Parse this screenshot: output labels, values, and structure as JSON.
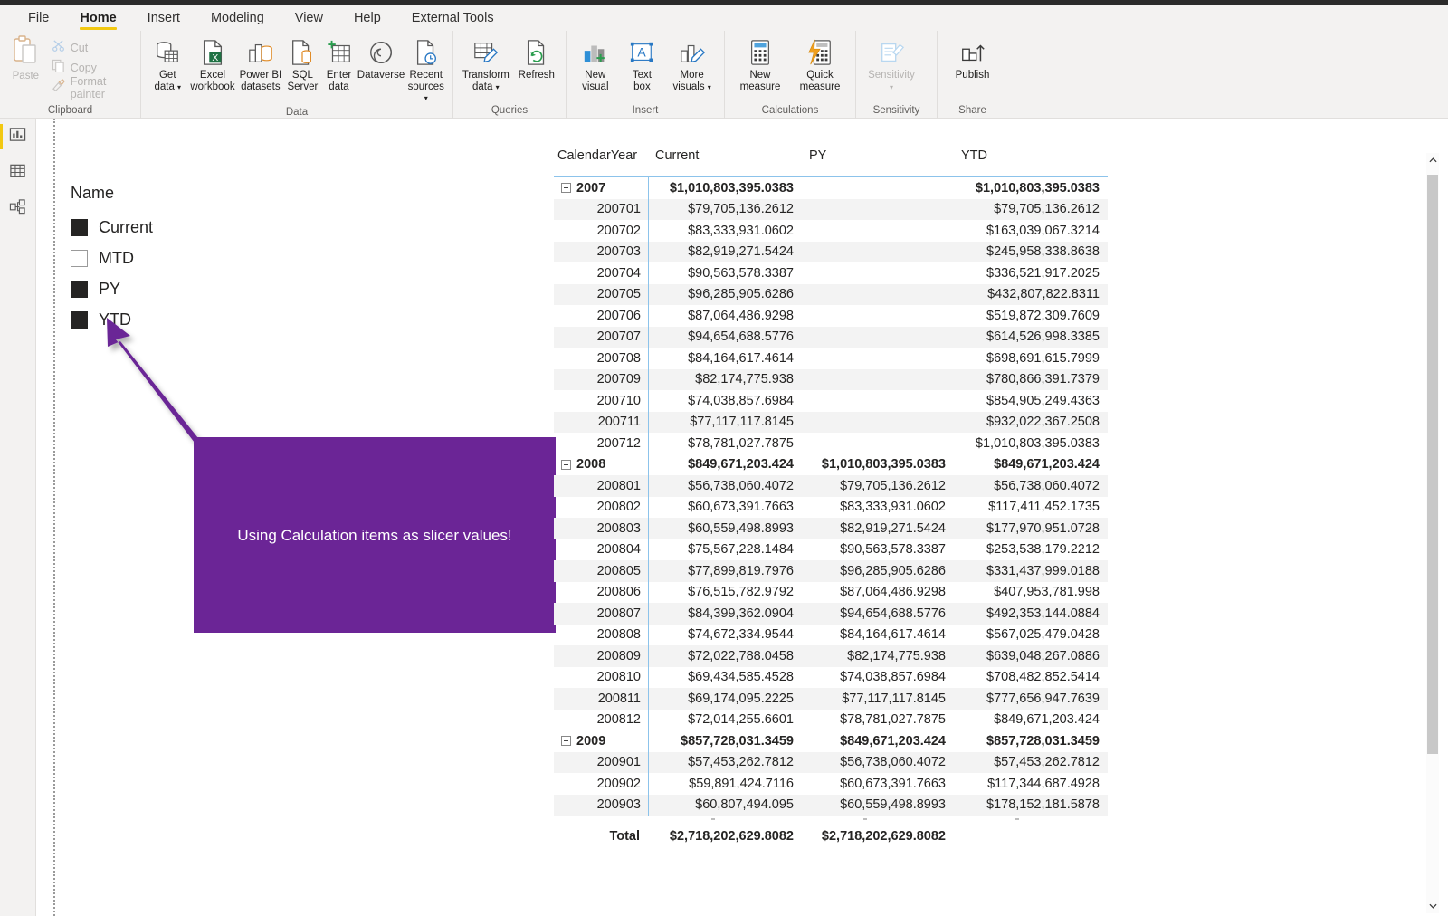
{
  "ribbon": {
    "tabs": [
      {
        "label": "File",
        "active": false
      },
      {
        "label": "Home",
        "active": true
      },
      {
        "label": "Insert",
        "active": false
      },
      {
        "label": "Modeling",
        "active": false
      },
      {
        "label": "View",
        "active": false
      },
      {
        "label": "Help",
        "active": false
      },
      {
        "label": "External Tools",
        "active": false
      }
    ],
    "groups": [
      {
        "name": "Clipboard",
        "label": "Clipboard",
        "big": {
          "label": "Paste",
          "icon": "paste-icon",
          "disabled": true
        },
        "small": [
          {
            "label": "Cut",
            "icon": "scissors-icon",
            "disabled": true
          },
          {
            "label": "Copy",
            "icon": "copy-icon",
            "disabled": true
          },
          {
            "label": "Format painter",
            "icon": "format-painter-icon",
            "disabled": true
          }
        ]
      },
      {
        "name": "Data",
        "label": "Data",
        "items": [
          {
            "label": "Get\ndata",
            "line1": "Get",
            "line2": "data",
            "caret": true,
            "icon": "get-data-icon"
          },
          {
            "label": "Excel\nworkbook",
            "line1": "Excel",
            "line2": "workbook",
            "caret": false,
            "icon": "excel-workbook-icon"
          },
          {
            "label": "Power BI\ndatasets",
            "line1": "Power BI",
            "line2": "datasets",
            "caret": false,
            "icon": "powerbi-datasets-icon"
          },
          {
            "label": "SQL\nServer",
            "line1": "SQL",
            "line2": "Server",
            "caret": false,
            "icon": "sql-server-icon"
          },
          {
            "label": "Enter\ndata",
            "line1": "Enter",
            "line2": "data",
            "caret": false,
            "icon": "enter-data-icon"
          },
          {
            "label": "Dataverse",
            "line1": "Dataverse",
            "line2": "",
            "caret": false,
            "icon": "dataverse-icon"
          },
          {
            "label": "Recent\nsources",
            "line1": "Recent",
            "line2": "sources",
            "caret": true,
            "icon": "recent-sources-icon"
          }
        ]
      },
      {
        "name": "Queries",
        "label": "Queries",
        "items": [
          {
            "line1": "Transform",
            "line2": "data",
            "caret": true,
            "icon": "transform-data-icon"
          },
          {
            "line1": "Refresh",
            "line2": "",
            "caret": false,
            "icon": "refresh-icon"
          }
        ]
      },
      {
        "name": "Insert",
        "label": "Insert",
        "items": [
          {
            "line1": "New",
            "line2": "visual",
            "caret": false,
            "icon": "new-visual-icon"
          },
          {
            "line1": "Text",
            "line2": "box",
            "caret": false,
            "icon": "text-box-icon"
          },
          {
            "line1": "More",
            "line2": "visuals",
            "caret": true,
            "icon": "more-visuals-icon"
          }
        ]
      },
      {
        "name": "Calculations",
        "label": "Calculations",
        "items": [
          {
            "line1": "New",
            "line2": "measure",
            "caret": false,
            "icon": "new-measure-icon"
          },
          {
            "line1": "Quick",
            "line2": "measure",
            "caret": false,
            "icon": "quick-measure-icon"
          }
        ]
      },
      {
        "name": "Sensitivity",
        "label": "Sensitivity",
        "items": [
          {
            "line1": "Sensitivity",
            "line2": "",
            "caret": true,
            "icon": "sensitivity-icon",
            "disabled": true
          }
        ]
      },
      {
        "name": "Share",
        "label": "Share",
        "items": [
          {
            "line1": "Publish",
            "line2": "",
            "caret": false,
            "icon": "publish-icon"
          }
        ]
      }
    ]
  },
  "navrail": {
    "items": [
      {
        "name": "report-view",
        "icon": "report-bar-chart-icon",
        "active": true
      },
      {
        "name": "data-view",
        "icon": "data-table-icon",
        "active": false
      },
      {
        "name": "model-view",
        "icon": "model-relationships-icon",
        "active": false
      }
    ]
  },
  "slicer": {
    "title": "Name",
    "items": [
      {
        "label": "Current",
        "selected": true
      },
      {
        "label": "MTD",
        "selected": false
      },
      {
        "label": "PY",
        "selected": true
      },
      {
        "label": "YTD",
        "selected": true
      }
    ]
  },
  "callout": {
    "text": "Using Calculation items as slicer values!",
    "color": "#6b2596"
  },
  "matrix": {
    "columns": [
      "CalendarYear",
      "Current",
      "PY",
      "YTD"
    ],
    "rows": [
      {
        "type": "year",
        "label": "2007",
        "current": "$1,010,803,395.0383",
        "py": "",
        "ytd": "$1,010,803,395.0383"
      },
      {
        "type": "month",
        "label": "200701",
        "current": "$79,705,136.2612",
        "py": "",
        "ytd": "$79,705,136.2612"
      },
      {
        "type": "month",
        "label": "200702",
        "current": "$83,333,931.0602",
        "py": "",
        "ytd": "$163,039,067.3214"
      },
      {
        "type": "month",
        "label": "200703",
        "current": "$82,919,271.5424",
        "py": "",
        "ytd": "$245,958,338.8638"
      },
      {
        "type": "month",
        "label": "200704",
        "current": "$90,563,578.3387",
        "py": "",
        "ytd": "$336,521,917.2025"
      },
      {
        "type": "month",
        "label": "200705",
        "current": "$96,285,905.6286",
        "py": "",
        "ytd": "$432,807,822.8311"
      },
      {
        "type": "month",
        "label": "200706",
        "current": "$87,064,486.9298",
        "py": "",
        "ytd": "$519,872,309.7609"
      },
      {
        "type": "month",
        "label": "200707",
        "current": "$94,654,688.5776",
        "py": "",
        "ytd": "$614,526,998.3385"
      },
      {
        "type": "month",
        "label": "200708",
        "current": "$84,164,617.4614",
        "py": "",
        "ytd": "$698,691,615.7999"
      },
      {
        "type": "month",
        "label": "200709",
        "current": "$82,174,775.938",
        "py": "",
        "ytd": "$780,866,391.7379"
      },
      {
        "type": "month",
        "label": "200710",
        "current": "$74,038,857.6984",
        "py": "",
        "ytd": "$854,905,249.4363"
      },
      {
        "type": "month",
        "label": "200711",
        "current": "$77,117,117.8145",
        "py": "",
        "ytd": "$932,022,367.2508"
      },
      {
        "type": "month",
        "label": "200712",
        "current": "$78,781,027.7875",
        "py": "",
        "ytd": "$1,010,803,395.0383"
      },
      {
        "type": "year",
        "label": "2008",
        "current": "$849,671,203.424",
        "py": "$1,010,803,395.0383",
        "ytd": "$849,671,203.424"
      },
      {
        "type": "month",
        "label": "200801",
        "current": "$56,738,060.4072",
        "py": "$79,705,136.2612",
        "ytd": "$56,738,060.4072"
      },
      {
        "type": "month",
        "label": "200802",
        "current": "$60,673,391.7663",
        "py": "$83,333,931.0602",
        "ytd": "$117,411,452.1735"
      },
      {
        "type": "month",
        "label": "200803",
        "current": "$60,559,498.8993",
        "py": "$82,919,271.5424",
        "ytd": "$177,970,951.0728"
      },
      {
        "type": "month",
        "label": "200804",
        "current": "$75,567,228.1484",
        "py": "$90,563,578.3387",
        "ytd": "$253,538,179.2212"
      },
      {
        "type": "month",
        "label": "200805",
        "current": "$77,899,819.7976",
        "py": "$96,285,905.6286",
        "ytd": "$331,437,999.0188"
      },
      {
        "type": "month",
        "label": "200806",
        "current": "$76,515,782.9792",
        "py": "$87,064,486.9298",
        "ytd": "$407,953,781.998"
      },
      {
        "type": "month",
        "label": "200807",
        "current": "$84,399,362.0904",
        "py": "$94,654,688.5776",
        "ytd": "$492,353,144.0884"
      },
      {
        "type": "month",
        "label": "200808",
        "current": "$74,672,334.9544",
        "py": "$84,164,617.4614",
        "ytd": "$567,025,479.0428"
      },
      {
        "type": "month",
        "label": "200809",
        "current": "$72,022,788.0458",
        "py": "$82,174,775.938",
        "ytd": "$639,048,267.0886"
      },
      {
        "type": "month",
        "label": "200810",
        "current": "$69,434,585.4528",
        "py": "$74,038,857.6984",
        "ytd": "$708,482,852.5414"
      },
      {
        "type": "month",
        "label": "200811",
        "current": "$69,174,095.2225",
        "py": "$77,117,117.8145",
        "ytd": "$777,656,947.7639"
      },
      {
        "type": "month",
        "label": "200812",
        "current": "$72,014,255.6601",
        "py": "$78,781,027.7875",
        "ytd": "$849,671,203.424"
      },
      {
        "type": "year",
        "label": "2009",
        "current": "$857,728,031.3459",
        "py": "$849,671,203.424",
        "ytd": "$857,728,031.3459"
      },
      {
        "type": "month",
        "label": "200901",
        "current": "$57,453,262.7812",
        "py": "$56,738,060.4072",
        "ytd": "$57,453,262.7812"
      },
      {
        "type": "month",
        "label": "200902",
        "current": "$59,891,424.7116",
        "py": "$60,673,391.7663",
        "ytd": "$117,344,687.4928"
      },
      {
        "type": "month",
        "label": "200903",
        "current": "$60,807,494.095",
        "py": "$60,559,498.8993",
        "ytd": "$178,152,181.5878"
      }
    ],
    "total": {
      "label": "Total",
      "current": "$2,718,202,629.8082",
      "py": "$2,718,202,629.8082",
      "ytd": ""
    }
  },
  "scrollbar": {
    "up_icon": "chevron-up-icon",
    "down_icon": "chevron-down-icon"
  }
}
